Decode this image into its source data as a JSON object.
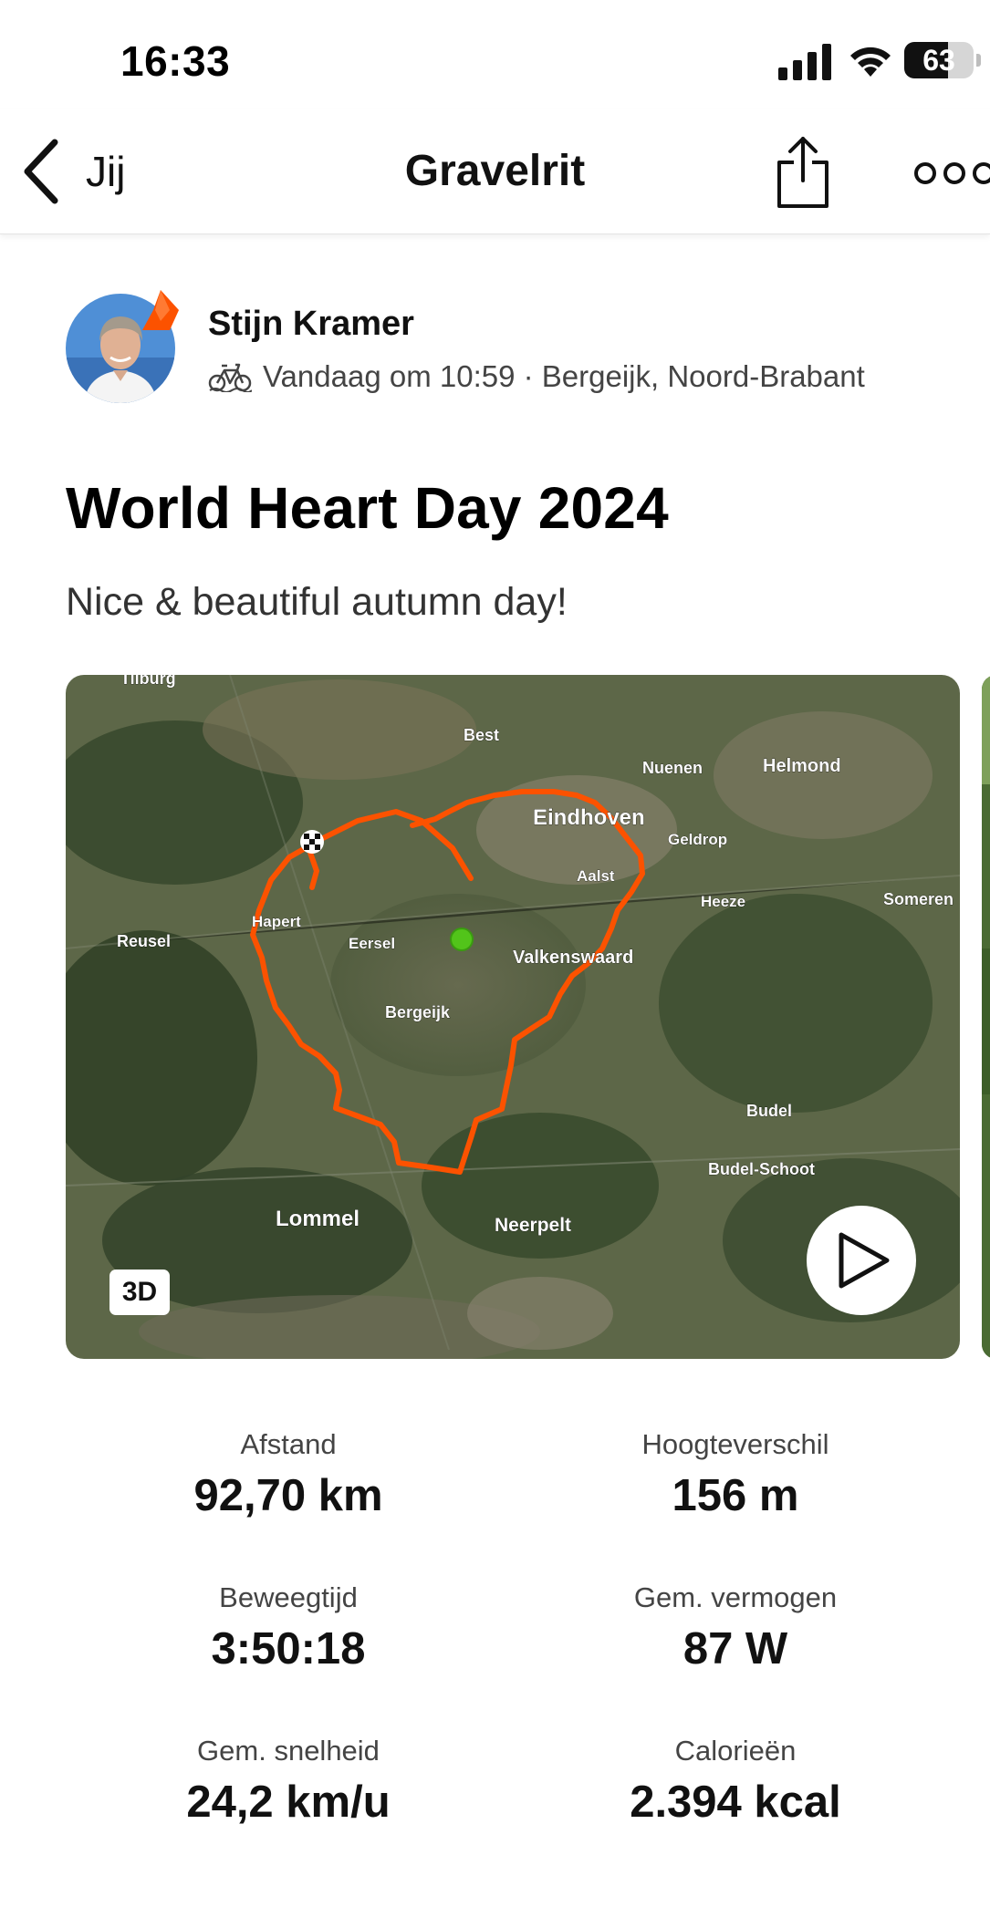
{
  "status_bar": {
    "time": "16:33",
    "battery": "63",
    "battery_level": 0.63
  },
  "nav": {
    "back_label": "Jij",
    "title": "Gravelrit"
  },
  "athlete": {
    "name": "Stijn Kramer",
    "meta": "Vandaag om 10:59 · Bergeijk, Noord-Brabant",
    "activity_icon": "bike-icon"
  },
  "activity": {
    "title": "World Heart Day 2024",
    "description": "Nice & beautiful autumn day!"
  },
  "map": {
    "badge": "3D",
    "places": {
      "tilburg": "Tilburg",
      "best": "Best",
      "nuenen": "Nuenen",
      "helmond": "Helmond",
      "eindhoven": "Eindhoven",
      "geldrop": "Geldrop",
      "aalst": "Aalst",
      "heeze": "Heeze",
      "someren": "Someren",
      "reusel": "Reusel",
      "hapert": "Hapert",
      "eersel": "Eersel",
      "valkenswaard": "Valkenswaard",
      "bergeijk": "Bergeijk",
      "budel": "Budel",
      "budel_schoot": "Budel-Schoot",
      "lommel": "Lommel",
      "neerpelt": "Neerpelt"
    },
    "route_color": "#fc5200",
    "start_color": "#52c41a"
  },
  "stats": {
    "distance": {
      "label": "Afstand",
      "value": "92,70 km"
    },
    "elevation": {
      "label": "Hoogteverschil",
      "value": "156 m"
    },
    "moving_time": {
      "label": "Beweegtijd",
      "value": "3:50:18"
    },
    "power": {
      "label": "Gem. vermogen",
      "value": "87 W"
    },
    "speed": {
      "label": "Gem. snelheid",
      "value": "24,2 km/u"
    },
    "calories": {
      "label": "Calorieën",
      "value": "2.394 kcal"
    }
  }
}
